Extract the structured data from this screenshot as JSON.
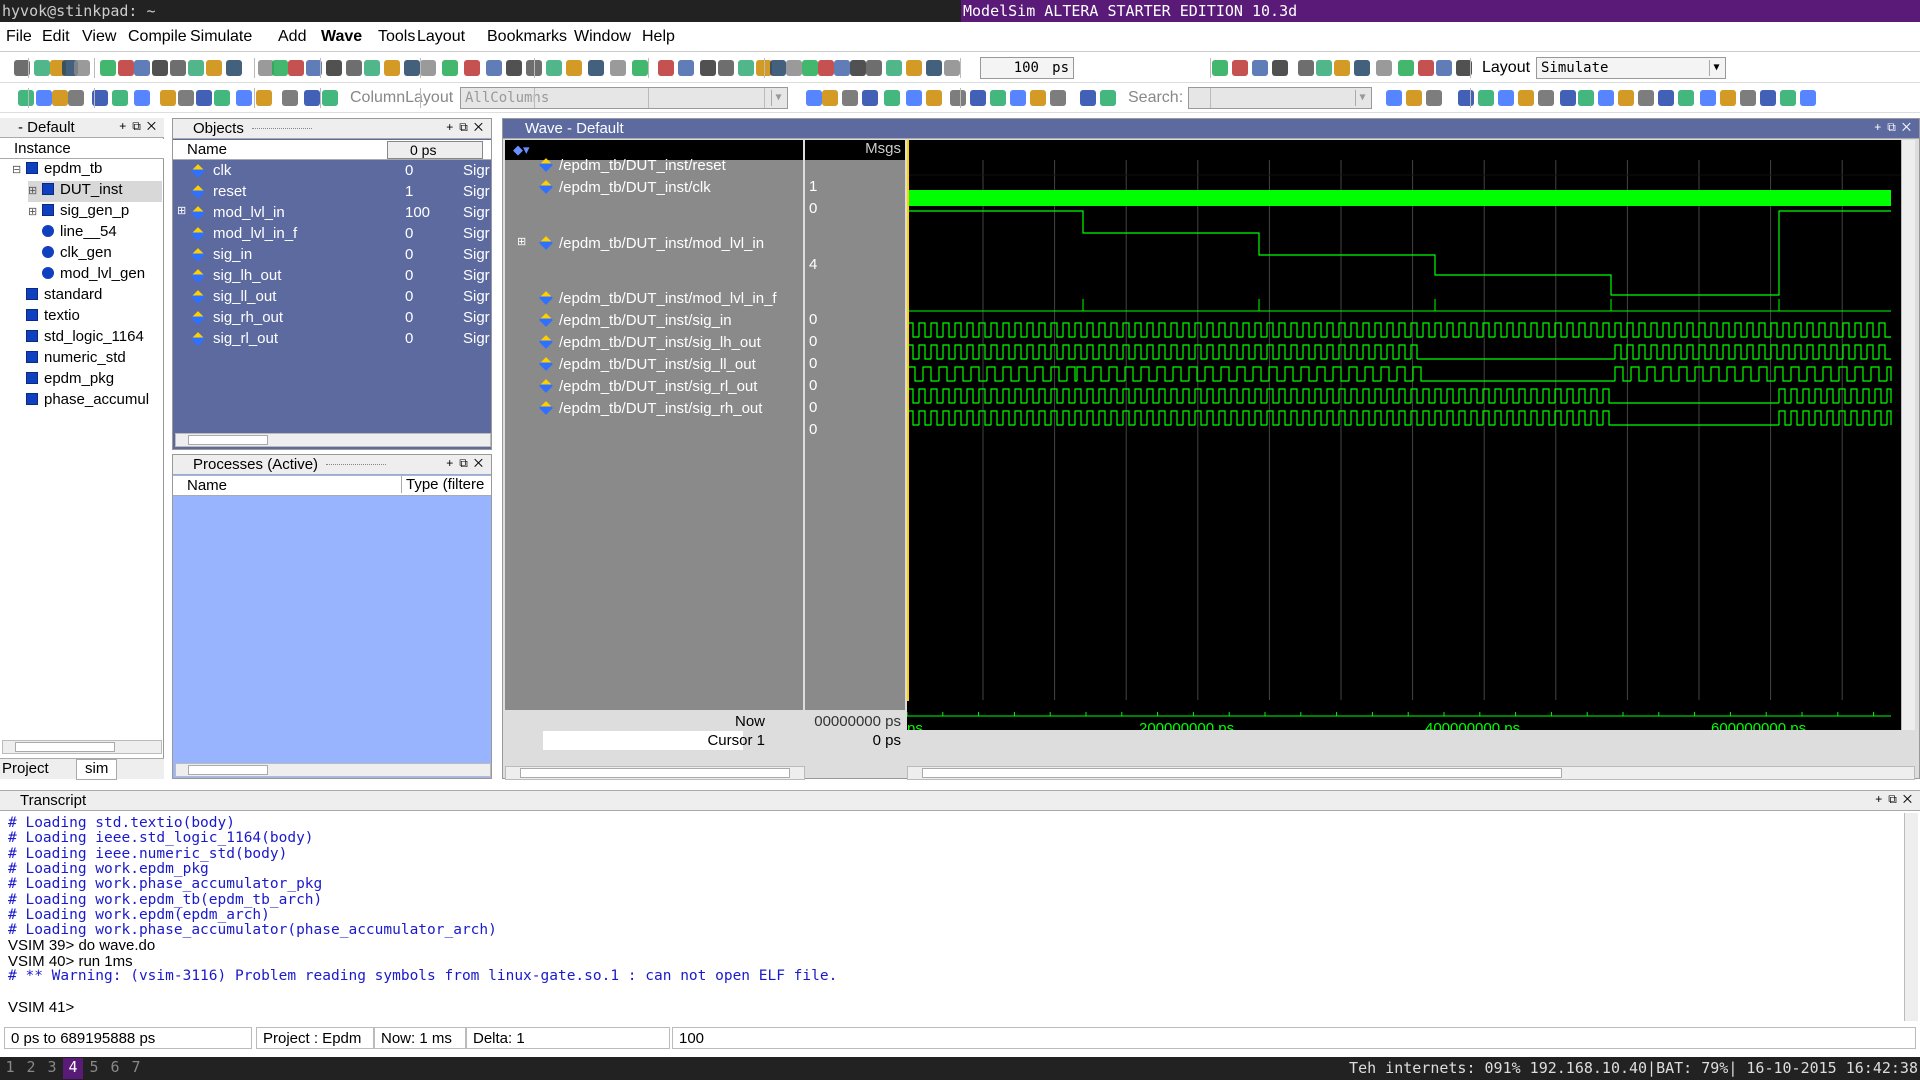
{
  "wm": {
    "host": "hyvok@stinkpad: ~",
    "title": "ModelSim ALTERA STARTER EDITION 10.3d"
  },
  "menu": [
    "File",
    "Edit",
    "View",
    "Compile",
    "Simulate",
    "Add",
    "Wave",
    "Tools",
    "Layout",
    "Bookmarks",
    "Window",
    "Help"
  ],
  "toolbar": {
    "zoom_value": "100",
    "zoom_unit": "ps",
    "layout_label": "Layout",
    "layout_value": "Simulate",
    "column_layout_label": "ColumnLayout",
    "column_layout_value": "AllColumns",
    "search_label": "Search:"
  },
  "instance_pane": {
    "title": "- Default",
    "col": "Instance",
    "items": [
      {
        "label": "epdm_tb",
        "indent": 0,
        "icon": "sq",
        "exp": "-"
      },
      {
        "label": "DUT_inst",
        "indent": 1,
        "icon": "sq",
        "exp": "+"
      },
      {
        "label": "sig_gen_p",
        "indent": 1,
        "icon": "sq",
        "exp": "+"
      },
      {
        "label": "line__54",
        "indent": 1,
        "icon": "cir",
        "exp": ""
      },
      {
        "label": "clk_gen",
        "indent": 1,
        "icon": "cir",
        "exp": ""
      },
      {
        "label": "mod_lvl_gen",
        "indent": 1,
        "icon": "cir",
        "exp": ""
      },
      {
        "label": "standard",
        "indent": 0,
        "icon": "sq",
        "exp": ""
      },
      {
        "label": "textio",
        "indent": 0,
        "icon": "sq",
        "exp": ""
      },
      {
        "label": "std_logic_1164",
        "indent": 0,
        "icon": "sq",
        "exp": ""
      },
      {
        "label": "numeric_std",
        "indent": 0,
        "icon": "sq",
        "exp": ""
      },
      {
        "label": "epdm_pkg",
        "indent": 0,
        "icon": "sq",
        "exp": ""
      },
      {
        "label": "phase_accumul",
        "indent": 0,
        "icon": "sq",
        "exp": ""
      }
    ],
    "tabs": [
      "Project",
      "sim"
    ]
  },
  "objects_pane": {
    "title": "Objects",
    "col_name": "Name",
    "time_filter": "0 ps",
    "rows": [
      {
        "name": "clk",
        "value": "0",
        "kind": "Sigr"
      },
      {
        "name": "reset",
        "value": "1",
        "kind": "Sigr"
      },
      {
        "name": "mod_lvl_in",
        "value": "100",
        "kind": "Sigr",
        "exp": "+"
      },
      {
        "name": "mod_lvl_in_f",
        "value": "0",
        "kind": "Sigr"
      },
      {
        "name": "sig_in",
        "value": "0",
        "kind": "Sigr"
      },
      {
        "name": "sig_lh_out",
        "value": "0",
        "kind": "Sigr"
      },
      {
        "name": "sig_ll_out",
        "value": "0",
        "kind": "Sigr"
      },
      {
        "name": "sig_rh_out",
        "value": "0",
        "kind": "Sigr"
      },
      {
        "name": "sig_rl_out",
        "value": "0",
        "kind": "Sigr"
      }
    ]
  },
  "processes_pane": {
    "title": "Processes (Active)",
    "col_name": "Name",
    "col_type": "Type (filtere"
  },
  "wave_pane": {
    "title": "Wave - Default",
    "msgs_header": "Msgs",
    "signals": [
      {
        "name": "/epdm_tb/DUT_inst/reset",
        "msg": "1"
      },
      {
        "name": "/epdm_tb/DUT_inst/clk",
        "msg": "0"
      },
      {
        "name": "/epdm_tb/DUT_inst/mod_lvl_in",
        "msg": "4",
        "exp": "+"
      },
      {
        "name": "/epdm_tb/DUT_inst/mod_lvl_in_f",
        "msg": "0"
      },
      {
        "name": "/epdm_tb/DUT_inst/sig_in",
        "msg": "0"
      },
      {
        "name": "/epdm_tb/DUT_inst/sig_lh_out",
        "msg": "0"
      },
      {
        "name": "/epdm_tb/DUT_inst/sig_ll_out",
        "msg": "0"
      },
      {
        "name": "/epdm_tb/DUT_inst/sig_rl_out",
        "msg": "0"
      },
      {
        "name": "/epdm_tb/DUT_inst/sig_rh_out",
        "msg": "0"
      }
    ],
    "now_label": "Now",
    "now_value": "00000000 ps",
    "cursor_label": "Cursor 1",
    "cursor_value": "0 ps",
    "cursor_time_tag": "0 ps",
    "time_ticks": [
      "ps",
      "200000000 ps",
      "400000000 ps",
      "600000000 ps"
    ]
  },
  "transcript": {
    "title": "Transcript",
    "lines": [
      {
        "text": "# Loading std.textio(body)",
        "cmd": false
      },
      {
        "text": "# Loading ieee.std_logic_1164(body)",
        "cmd": false
      },
      {
        "text": "# Loading ieee.numeric_std(body)",
        "cmd": false
      },
      {
        "text": "# Loading work.epdm_pkg",
        "cmd": false
      },
      {
        "text": "# Loading work.phase_accumulator_pkg",
        "cmd": false
      },
      {
        "text": "# Loading work.epdm_tb(epdm_tb_arch)",
        "cmd": false
      },
      {
        "text": "# Loading work.epdm(epdm_arch)",
        "cmd": false
      },
      {
        "text": "# Loading work.phase_accumulator(phase_accumulator_arch)",
        "cmd": false
      },
      {
        "text": "VSIM 39> do wave.do",
        "cmd": true
      },
      {
        "text": "VSIM 40> run 1ms",
        "cmd": true
      },
      {
        "text": "# ** Warning: (vsim-3116) Problem reading symbols from linux-gate.so.1 : can not open ELF file.",
        "cmd": false
      },
      {
        "text": "",
        "cmd": false
      },
      {
        "text": "VSIM 41>",
        "cmd": true
      }
    ]
  },
  "statusbar": {
    "range": "0 ps to 689195888 ps",
    "project": "Project : Epdm",
    "now": "Now: 1 ms",
    "delta": "Delta: 1",
    "value": "100"
  },
  "bottom": {
    "workspaces": [
      "1",
      "2",
      "3",
      "4",
      "5",
      "6",
      "7"
    ],
    "active_ws": 3,
    "info": "Teh internets: 091% 192.168.10.40|BAT: 79%| 16-10-2015 16:42:38"
  },
  "colors": {
    "wave_green": "#00ff00",
    "wave_bg": "#000000",
    "obj_bg": "#5c6aa0",
    "proc_bg": "#98b4ff",
    "cursor": "#ffd000"
  }
}
